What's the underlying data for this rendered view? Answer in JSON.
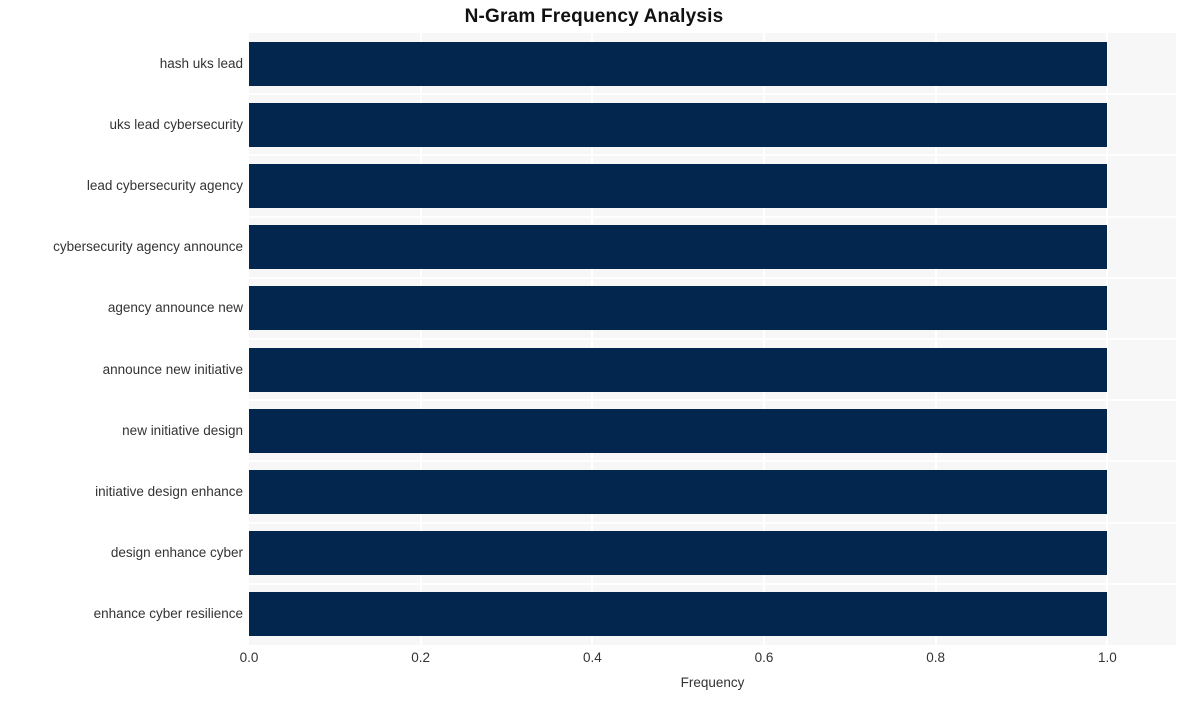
{
  "chart_data": {
    "type": "bar",
    "orientation": "horizontal",
    "title": "N-Gram Frequency Analysis",
    "xlabel": "Frequency",
    "ylabel": "",
    "categories": [
      "hash uks lead",
      "uks lead cybersecurity",
      "lead cybersecurity agency",
      "cybersecurity agency announce",
      "agency announce new",
      "announce new initiative",
      "new initiative design",
      "initiative design enhance",
      "design enhance cyber",
      "enhance cyber resilience"
    ],
    "values": [
      1.0,
      1.0,
      1.0,
      1.0,
      1.0,
      1.0,
      1.0,
      1.0,
      1.0,
      1.0
    ],
    "xlim": [
      0.0,
      1.08
    ],
    "xticks": [
      0.0,
      0.2,
      0.4,
      0.6,
      0.8,
      1.0
    ],
    "xtick_labels": [
      "0.0",
      "0.2",
      "0.4",
      "0.6",
      "0.8",
      "1.0"
    ],
    "grid": true,
    "legend": false,
    "bar_color": "#02264d",
    "plot_background": "#f7f7f7",
    "gridline_color": "#ffffff",
    "figure_background": "#ffffff"
  }
}
